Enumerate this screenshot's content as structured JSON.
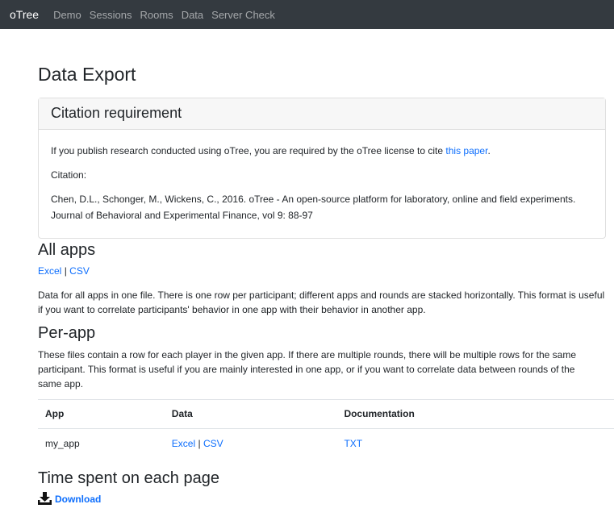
{
  "navbar": {
    "brand": "oTree",
    "links": [
      "Demo",
      "Sessions",
      "Rooms",
      "Data",
      "Server Check"
    ]
  },
  "page_title": "Data Export",
  "citation": {
    "header": "Citation requirement",
    "intro": "If you publish research conducted using oTree, you are required by the oTree license to cite ",
    "link_text": "this paper",
    "intro_end": ".",
    "label": "Citation:",
    "text": "Chen, D.L., Schonger, M., Wickens, C., 2016. oTree - An open-source platform for laboratory, online and field experiments. Journal of Behavioral and Experimental Finance, vol 9: 88-97"
  },
  "all_apps": {
    "heading": "All apps",
    "excel": "Excel",
    "separator": "|",
    "csv": "CSV",
    "description": "Data for all apps in one file. There is one row per participant; different apps and rounds are stacked horizontally. This format is useful if you want to correlate participants' behavior in one app with their behavior in another app."
  },
  "per_app": {
    "heading": "Per-app",
    "description": "These files contain a row for each player in the given app. If there are multiple rounds, there will be multiple rows for the same participant. This format is useful if you are mainly interested in one app, or if you want to correlate data between rounds of the same app.",
    "table": {
      "headers": [
        "App",
        "Data",
        "Documentation"
      ],
      "rows": [
        {
          "app": "my_app",
          "excel": "Excel",
          "separator": "|",
          "csv": "CSV",
          "doc": "TXT"
        }
      ]
    }
  },
  "time_spent": {
    "heading": "Time spent on each page",
    "download": "Download",
    "icon": "download-icon"
  },
  "colors": {
    "navbar_bg": "#343a40",
    "link": "#0d6efd",
    "card_header_bg": "#f7f7f7"
  }
}
